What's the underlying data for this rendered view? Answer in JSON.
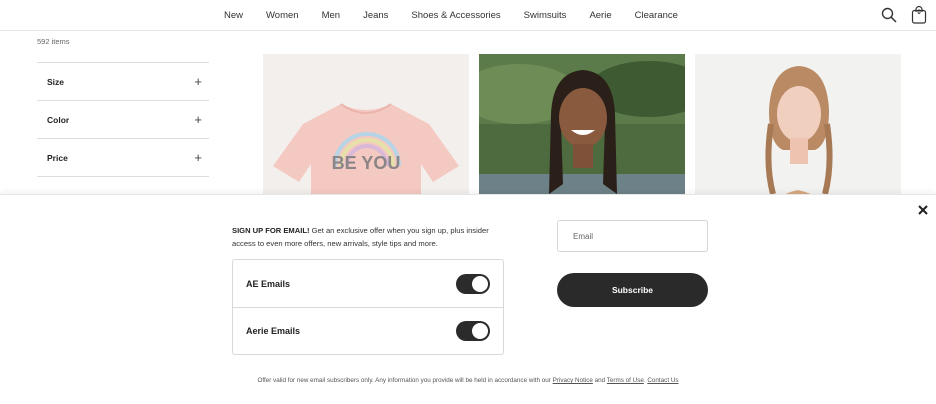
{
  "nav": {
    "items": [
      "New",
      "Women",
      "Men",
      "Jeans",
      "Shoes & Accessories",
      "Swimsuits",
      "Aerie",
      "Clearance"
    ],
    "bag_count": "0"
  },
  "sidebar": {
    "item_count": "592 items",
    "filters": [
      "Size",
      "Color",
      "Price"
    ]
  },
  "products": {
    "tee_print_text": "BE YOU"
  },
  "signup": {
    "heading": "SIGN UP FOR EMAIL!",
    "body": " Get an exclusive offer when you sign up, plus insider access to even more offers, new arrivals, style tips and more.",
    "toggles": [
      {
        "label": "AE Emails",
        "on": true
      },
      {
        "label": "Aerie Emails",
        "on": true
      }
    ],
    "email_placeholder": "Email",
    "subscribe_label": "Subscribe",
    "legal_text": "Offer valid for new email subscribers only. Any information you provide will be held in accordance with our ",
    "privacy_link": "Privacy Notice",
    "and_text": " and ",
    "terms_link": "Terms of Use",
    "period": ". ",
    "contact_link": "Contact Us"
  }
}
